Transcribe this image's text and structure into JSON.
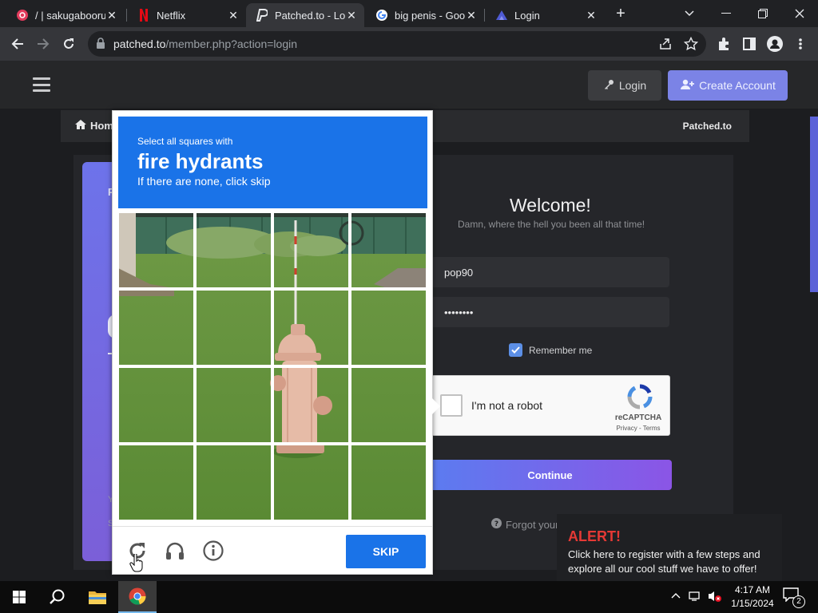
{
  "browser": {
    "tabs": [
      {
        "title": "/ | sakugabooru",
        "favicon": "sakugabooru-icon"
      },
      {
        "title": "Netflix",
        "favicon": "netflix-icon"
      },
      {
        "title": "Patched.to - Log",
        "favicon": "patched-icon",
        "active": true
      },
      {
        "title": "big penis - Goo",
        "favicon": "google-icon"
      },
      {
        "title": "Login",
        "favicon": "login-icon"
      }
    ],
    "close_glyph": "✕",
    "new_tab_glyph": "+",
    "url_host": "patched.to",
    "url_path": "/member.php?action=login"
  },
  "site": {
    "login_label": "Login",
    "create_account_label": "Create Account",
    "nav_home": "Hom",
    "nav_brand": "Patched.to",
    "welcome": "Welcome!",
    "subtitle": "Damn, where the hell you been all that time!",
    "username_value": "pop90",
    "password_value": "••••••••",
    "remember_label": "Remember me",
    "recaptcha_label": "I'm not a robot",
    "recaptcha_brand": "reCAPTCHA",
    "recaptcha_terms": "Privacy - Terms",
    "continue_label": "Continue",
    "forgot_label": "Forgot your",
    "left_frag_1": "P",
    "left_frag_2": "Y",
    "left_frag_3": "S",
    "alert_title": "ALERT!",
    "alert_message": "Click here to register with a few steps and explore all our cool stuff we have to offer!",
    "accent_color": "#7b83e6"
  },
  "challenge": {
    "line1": "Select all squares with",
    "target": "fire hydrants",
    "line3": "If there are none, click skip",
    "skip_label": "SKIP",
    "grid_size": 4,
    "header_color": "#1a73e8"
  },
  "taskbar": {
    "time": "4:17 AM",
    "date": "1/15/2024",
    "notification_count": "2"
  }
}
